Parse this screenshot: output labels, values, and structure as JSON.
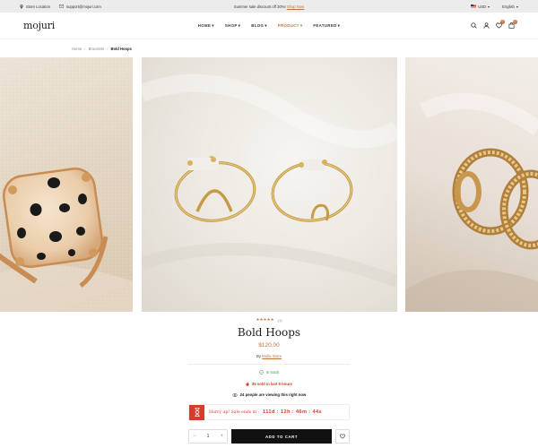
{
  "topbar": {
    "store_location": "Store Location",
    "email": "support@mojuri.com",
    "announcement": "Summer sale discount off 30%!",
    "shop_now": "Shop Now",
    "currency": "USD",
    "language": "English"
  },
  "header": {
    "logo": "mojuri",
    "nav": [
      {
        "label": "HOME",
        "caret": "▾"
      },
      {
        "label": "SHOP",
        "caret": "▾"
      },
      {
        "label": "BLOG",
        "caret": "▾"
      },
      {
        "label": "PRODUCT",
        "caret": "▾"
      },
      {
        "label": "FEATURED",
        "caret": "▾"
      }
    ],
    "active_nav": "PRODUCT",
    "wishlist_count": "0",
    "cart_count": "0"
  },
  "breadcrumb": {
    "items": [
      "Home",
      "Bracelets"
    ],
    "separator": "›",
    "current": "Bold Hoops"
  },
  "gallery": {
    "images": [
      "ring-with-black-spots",
      "two-gold-open-rings",
      "gold-chain-rings"
    ]
  },
  "product": {
    "stars": "★★★★★",
    "review_count": "(1)",
    "title": "Bold Hoops",
    "price": "$120.00",
    "by_label": "By",
    "vendor": "Molla Store",
    "stock": "In stock",
    "sold": "36 sold in last 8 hours",
    "viewing": "24 people are viewing this right now"
  },
  "sale": {
    "text": "Hurry up! Sale ends in :",
    "timer": "111d : 12h : 46m : 44s"
  },
  "purchase": {
    "minus": "−",
    "qty": "1",
    "plus": "+",
    "add_to_cart": "ADD TO CART"
  },
  "colors": {
    "accent": "#c4713c",
    "sale_red": "#d23c2a",
    "stock_green": "#3a9a4a",
    "button_black": "#111111"
  }
}
